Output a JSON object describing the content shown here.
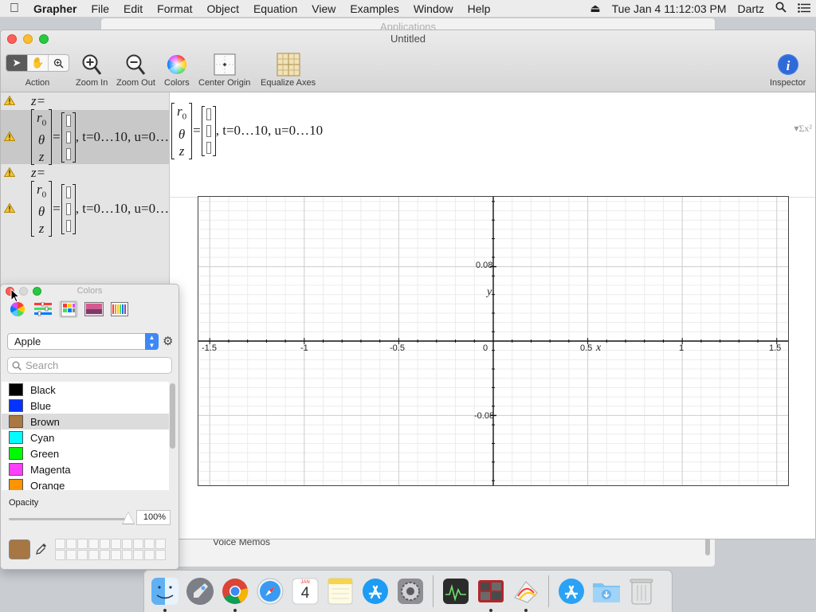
{
  "menubar": {
    "app": "Grapher",
    "items": [
      "File",
      "Edit",
      "Format",
      "Object",
      "Equation",
      "View",
      "Examples",
      "Window",
      "Help"
    ],
    "clock": "Tue Jan 4  11:12:03 PM",
    "user": "Dartz"
  },
  "background_window": {
    "title": "Applications",
    "row": "Voice Memos"
  },
  "window": {
    "title": "Untitled",
    "toolbar": {
      "action": "Action",
      "zoom_in": "Zoom In",
      "zoom_out": "Zoom Out",
      "colors": "Colors",
      "center_origin": "Center Origin",
      "equalize_axes": "Equalize Axes",
      "inspector": "Inspector"
    }
  },
  "equations": [
    {
      "lhs": "z=",
      "matrix": [
        "r0",
        "θ",
        "z"
      ],
      "params": ", t=0…10, u=0…"
    },
    {
      "lhs": "z=",
      "matrix": [
        "r0",
        "θ",
        "z"
      ],
      "params": ", t=0…10, u=0…"
    }
  ],
  "editor": {
    "matrix": [
      "r0",
      "θ",
      "z"
    ],
    "params": ", t=0…10, u=0…10"
  },
  "graph": {
    "x_ticks": [
      "-1.5",
      "-1",
      "-0.5",
      "0",
      "0.5",
      "1",
      "1.5"
    ],
    "y_ticks": [
      "0.08",
      "-0.08"
    ],
    "x_label": "x",
    "y_label": "y",
    "xlim": [
      -1.56,
      1.56
    ],
    "ylim": [
      -0.155,
      0.155
    ]
  },
  "colors_panel": {
    "title": "Colors",
    "palette": "Apple",
    "search_placeholder": "Search",
    "list": [
      {
        "name": "Black",
        "color": "#000000"
      },
      {
        "name": "Blue",
        "color": "#0433ff"
      },
      {
        "name": "Brown",
        "color": "#aa7942"
      },
      {
        "name": "Cyan",
        "color": "#00fdff"
      },
      {
        "name": "Green",
        "color": "#00f900"
      },
      {
        "name": "Magenta",
        "color": "#ff40ff"
      },
      {
        "name": "Orange",
        "color": "#ff9300"
      }
    ],
    "selected": "Brown",
    "opacity_label": "Opacity",
    "opacity_value": "100%",
    "opacity_level": 1.0,
    "current_color": "#a67643"
  },
  "dock": {
    "icons": [
      "finder-icon",
      "launchpad-icon",
      "chrome-icon",
      "safari-icon",
      "calendar-icon",
      "notes-icon",
      "app-store-icon",
      "system-preferences-icon",
      "activity-monitor-icon",
      "photo-booth-icon",
      "grapher-icon",
      "app-store-alt-icon",
      "downloads-folder-icon",
      "trash-icon"
    ],
    "calendar_month": "JAN",
    "calendar_day": "4"
  }
}
